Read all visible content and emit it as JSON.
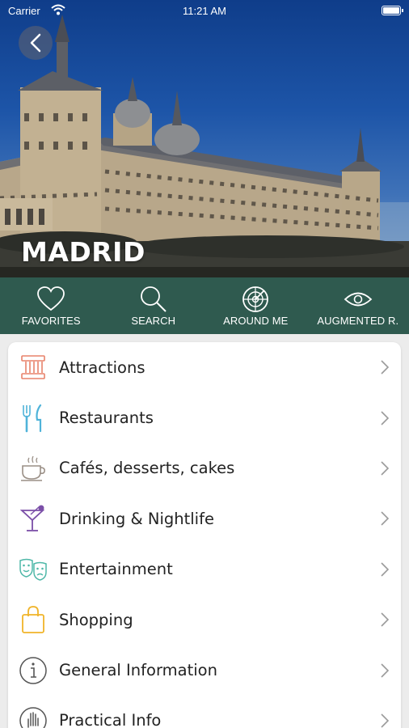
{
  "status": {
    "carrier": "Carrier",
    "time": "11:21 AM"
  },
  "hero": {
    "title": "MADRID"
  },
  "actions": [
    {
      "label": "FAVORITES",
      "icon": "heart-icon"
    },
    {
      "label": "SEARCH",
      "icon": "search-icon"
    },
    {
      "label": "AROUND ME",
      "icon": "radar-icon"
    },
    {
      "label": "AUGMENTED R.",
      "icon": "eye-icon"
    }
  ],
  "categories": [
    {
      "label": "Attractions",
      "icon": "monument-icon",
      "color": "#e8826a"
    },
    {
      "label": "Restaurants",
      "icon": "fork-knife-icon",
      "color": "#4fb3d9"
    },
    {
      "label": "Cafés, desserts, cakes",
      "icon": "coffee-cup-icon",
      "color": "#9a8f86"
    },
    {
      "label": "Drinking & Nightlife",
      "icon": "cocktail-icon",
      "color": "#7b4fa8"
    },
    {
      "label": "Entertainment",
      "icon": "theater-masks-icon",
      "color": "#4fb8a8"
    },
    {
      "label": "Shopping",
      "icon": "shopping-bag-icon",
      "color": "#f0b429"
    },
    {
      "label": "General Information",
      "icon": "info-icon",
      "color": "#555555"
    },
    {
      "label": "Practical Info",
      "icon": "hand-icon",
      "color": "#555555"
    }
  ],
  "colors": {
    "action_bar": "#2f5a4f",
    "chevron": "#9a9a9a"
  }
}
